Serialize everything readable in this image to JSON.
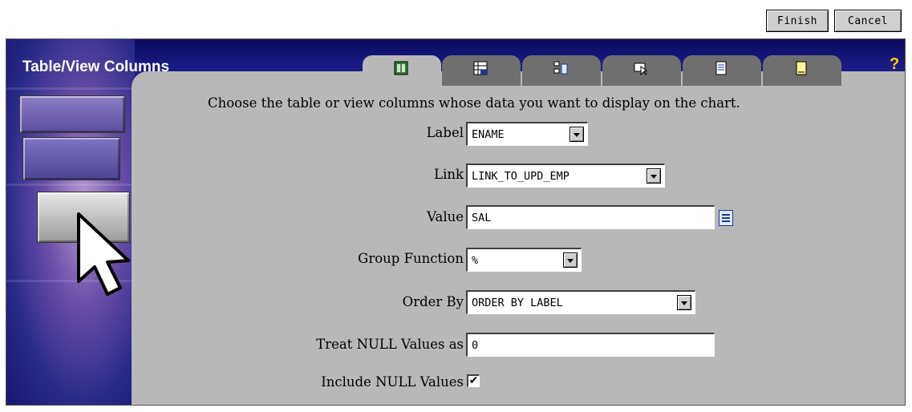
{
  "top_buttons": {
    "finish": "Finish",
    "cancel": "Cancel"
  },
  "header": {
    "title": "Table/View Columns",
    "help": "?"
  },
  "tabs": [
    {
      "icon": "table-icon",
      "active": true
    },
    {
      "icon": "xy-grid-icon",
      "active": false
    },
    {
      "icon": "data-select-icon",
      "active": false
    },
    {
      "icon": "pointer-window-icon",
      "active": false
    },
    {
      "icon": "document-icon",
      "active": false
    },
    {
      "icon": "note-icon",
      "active": false
    }
  ],
  "form": {
    "intro": "Choose the table or view columns whose data you want to display on the chart.",
    "label": {
      "caption": "Label",
      "value": "ENAME"
    },
    "link": {
      "caption": "Link",
      "value": "LINK_TO_UPD_EMP"
    },
    "value": {
      "caption": "Value",
      "value": "SAL"
    },
    "group_function": {
      "caption": "Group Function",
      "value": "%"
    },
    "order_by": {
      "caption": "Order By",
      "value": "ORDER BY LABEL"
    },
    "treat_null": {
      "caption": "Treat NULL Values as",
      "value": "0"
    },
    "include_null": {
      "caption": "Include NULL Values",
      "checked": true,
      "mark": "✔"
    }
  },
  "colors": {
    "header": "#1b1b86",
    "panel": "#b8b8b8",
    "tab_inactive": "#6f6f6f",
    "help": "#ffd400"
  }
}
